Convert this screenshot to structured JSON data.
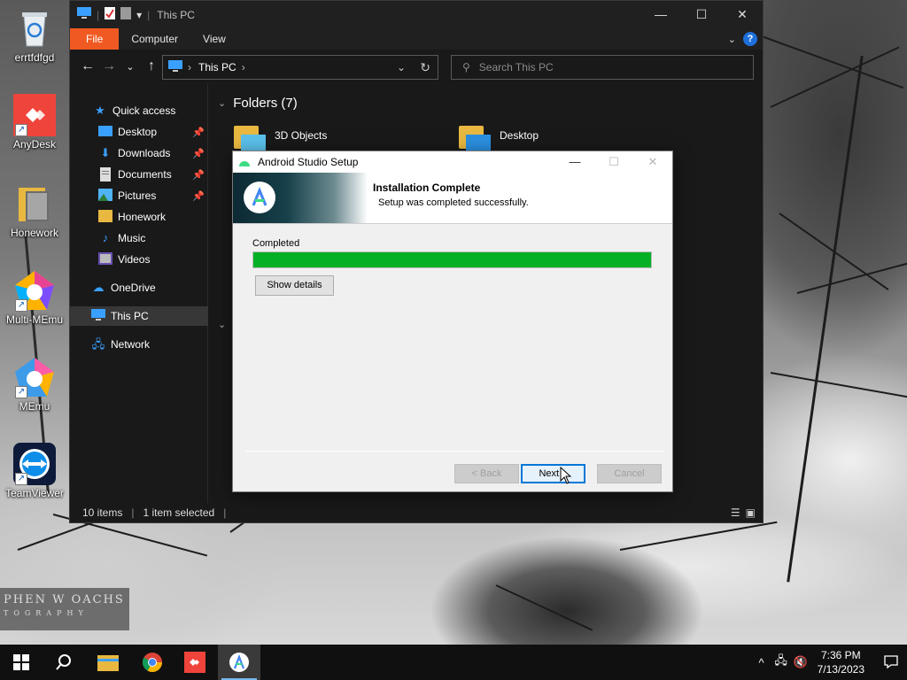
{
  "desktop": {
    "icons": [
      {
        "label": "errtfdfgd",
        "icon": "recycle-bin-icon"
      },
      {
        "label": "AnyDesk",
        "icon": "anydesk-icon"
      },
      {
        "label": "Honework",
        "icon": "folder-icon"
      },
      {
        "label": "Multi-MEmu",
        "icon": "multi-memu-icon"
      },
      {
        "label": "MEmu",
        "icon": "memu-icon"
      },
      {
        "label": "TeamViewer",
        "icon": "teamviewer-icon"
      }
    ],
    "watermark": {
      "line1": "PHEN W OACHS",
      "line2": "TOGRAPHY"
    }
  },
  "explorer": {
    "title": "This PC",
    "ribbon": {
      "file": "File",
      "computer": "Computer",
      "view": "View",
      "help": "?"
    },
    "address": {
      "crumb": "This PC"
    },
    "search": {
      "placeholder": "Search This PC"
    },
    "nav": {
      "quick_access": "Quick access",
      "desktop": "Desktop",
      "downloads": "Downloads",
      "documents": "Documents",
      "pictures": "Pictures",
      "honework": "Honework",
      "music": "Music",
      "videos": "Videos",
      "onedrive": "OneDrive",
      "this_pc": "This PC",
      "network": "Network"
    },
    "folders_header": "Folders (7)",
    "folders": [
      {
        "name": "3D Objects"
      },
      {
        "name": "Desktop"
      }
    ],
    "status": {
      "items": "10 items",
      "selected": "1 item selected"
    }
  },
  "setup_dialog": {
    "title": "Android Studio Setup",
    "heading": "Installation Complete",
    "subheading": "Setup was completed successfully.",
    "progress_label": "Completed",
    "progress_fraction": 1.0,
    "progress_color": "#06b025",
    "show_details": "Show details",
    "buttons": {
      "back": "< Back",
      "next": "Next >",
      "cancel": "Cancel"
    }
  },
  "taskbar": {
    "apps": [
      "start-icon",
      "search-icon",
      "file-explorer-icon",
      "chrome-icon",
      "anydesk-icon",
      "android-studio-icon"
    ],
    "clock": {
      "time": "7:36 PM",
      "date": "7/13/2023"
    }
  }
}
